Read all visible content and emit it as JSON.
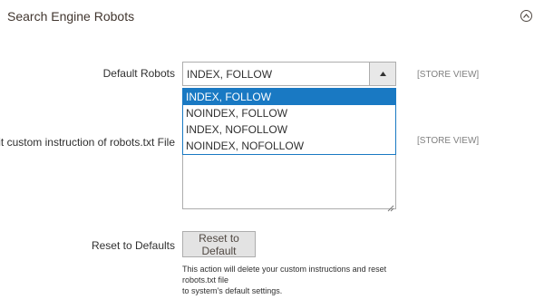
{
  "section": {
    "title": "Search Engine Robots",
    "collapse_icon": "chevron-up-icon"
  },
  "default_robots": {
    "label": "Default Robots",
    "selected": "INDEX, FOLLOW",
    "scope": "[STORE VIEW]",
    "arrow_icon": "caret-up-icon",
    "options": [
      "INDEX, FOLLOW",
      "NOINDEX, FOLLOW",
      "INDEX, NOFOLLOW",
      "NOINDEX, NOFOLLOW"
    ]
  },
  "custom_instruction": {
    "label": "Edit custom instruction of robots.txt File",
    "value": "",
    "scope": "[STORE VIEW]"
  },
  "reset": {
    "label": "Reset to Defaults",
    "button_label": "Reset to Default",
    "note_line1": "This action will delete your custom instructions and reset robots.txt file",
    "note_line2": "to system's default settings."
  },
  "colors": {
    "accent": "#1979c3",
    "button_bg": "#e3e3e3",
    "border": "#adadad",
    "scope_text": "#808080"
  }
}
